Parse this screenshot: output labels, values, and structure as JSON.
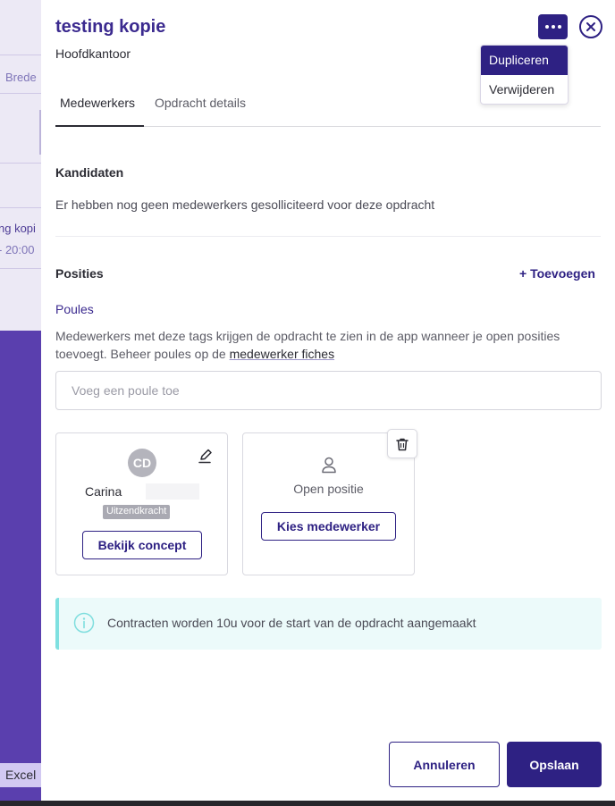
{
  "background": {
    "texts": [
      "Brede",
      "ng kopi",
      "- 20:00"
    ],
    "excel_label": "Excel"
  },
  "header": {
    "title": "testing kopie",
    "subtitle": "Hoofdkantoor"
  },
  "actions_menu": {
    "items": [
      "Dupliceren",
      "Verwijderen"
    ]
  },
  "tabs": [
    "Medewerkers",
    "Opdracht details"
  ],
  "candidates": {
    "heading": "Kandidaten",
    "empty_text": "Er hebben nog geen medewerkers gesolliciteerd voor deze opdracht"
  },
  "positions": {
    "heading": "Posities",
    "add_label": "+ Toevoegen",
    "poules_label": "Poules",
    "description": "Medewerkers met deze tags krijgen de opdracht te zien in de app wanneer je open posities toevoegt. Beheer poules op de",
    "description_link": "medewerker fiches",
    "poule_placeholder": "Voeg een poule toe",
    "cards": [
      {
        "initials": "CD",
        "name": "Carina",
        "role": "Uitzendkracht",
        "button": "Bekijk concept"
      },
      {
        "label": "Open positie",
        "button": "Kies medewerker"
      }
    ]
  },
  "info_banner": {
    "text": "Contracten worden 10u voor de start van de opdracht aangemaakt"
  },
  "footer": {
    "cancel": "Annuleren",
    "save": "Opslaan"
  },
  "colors": {
    "primary": "#2e2183",
    "title": "#3b2a8f",
    "info_bg": "#ecfafa",
    "info_accent": "#7fe0e0",
    "sidebar": "#5a3fae"
  }
}
